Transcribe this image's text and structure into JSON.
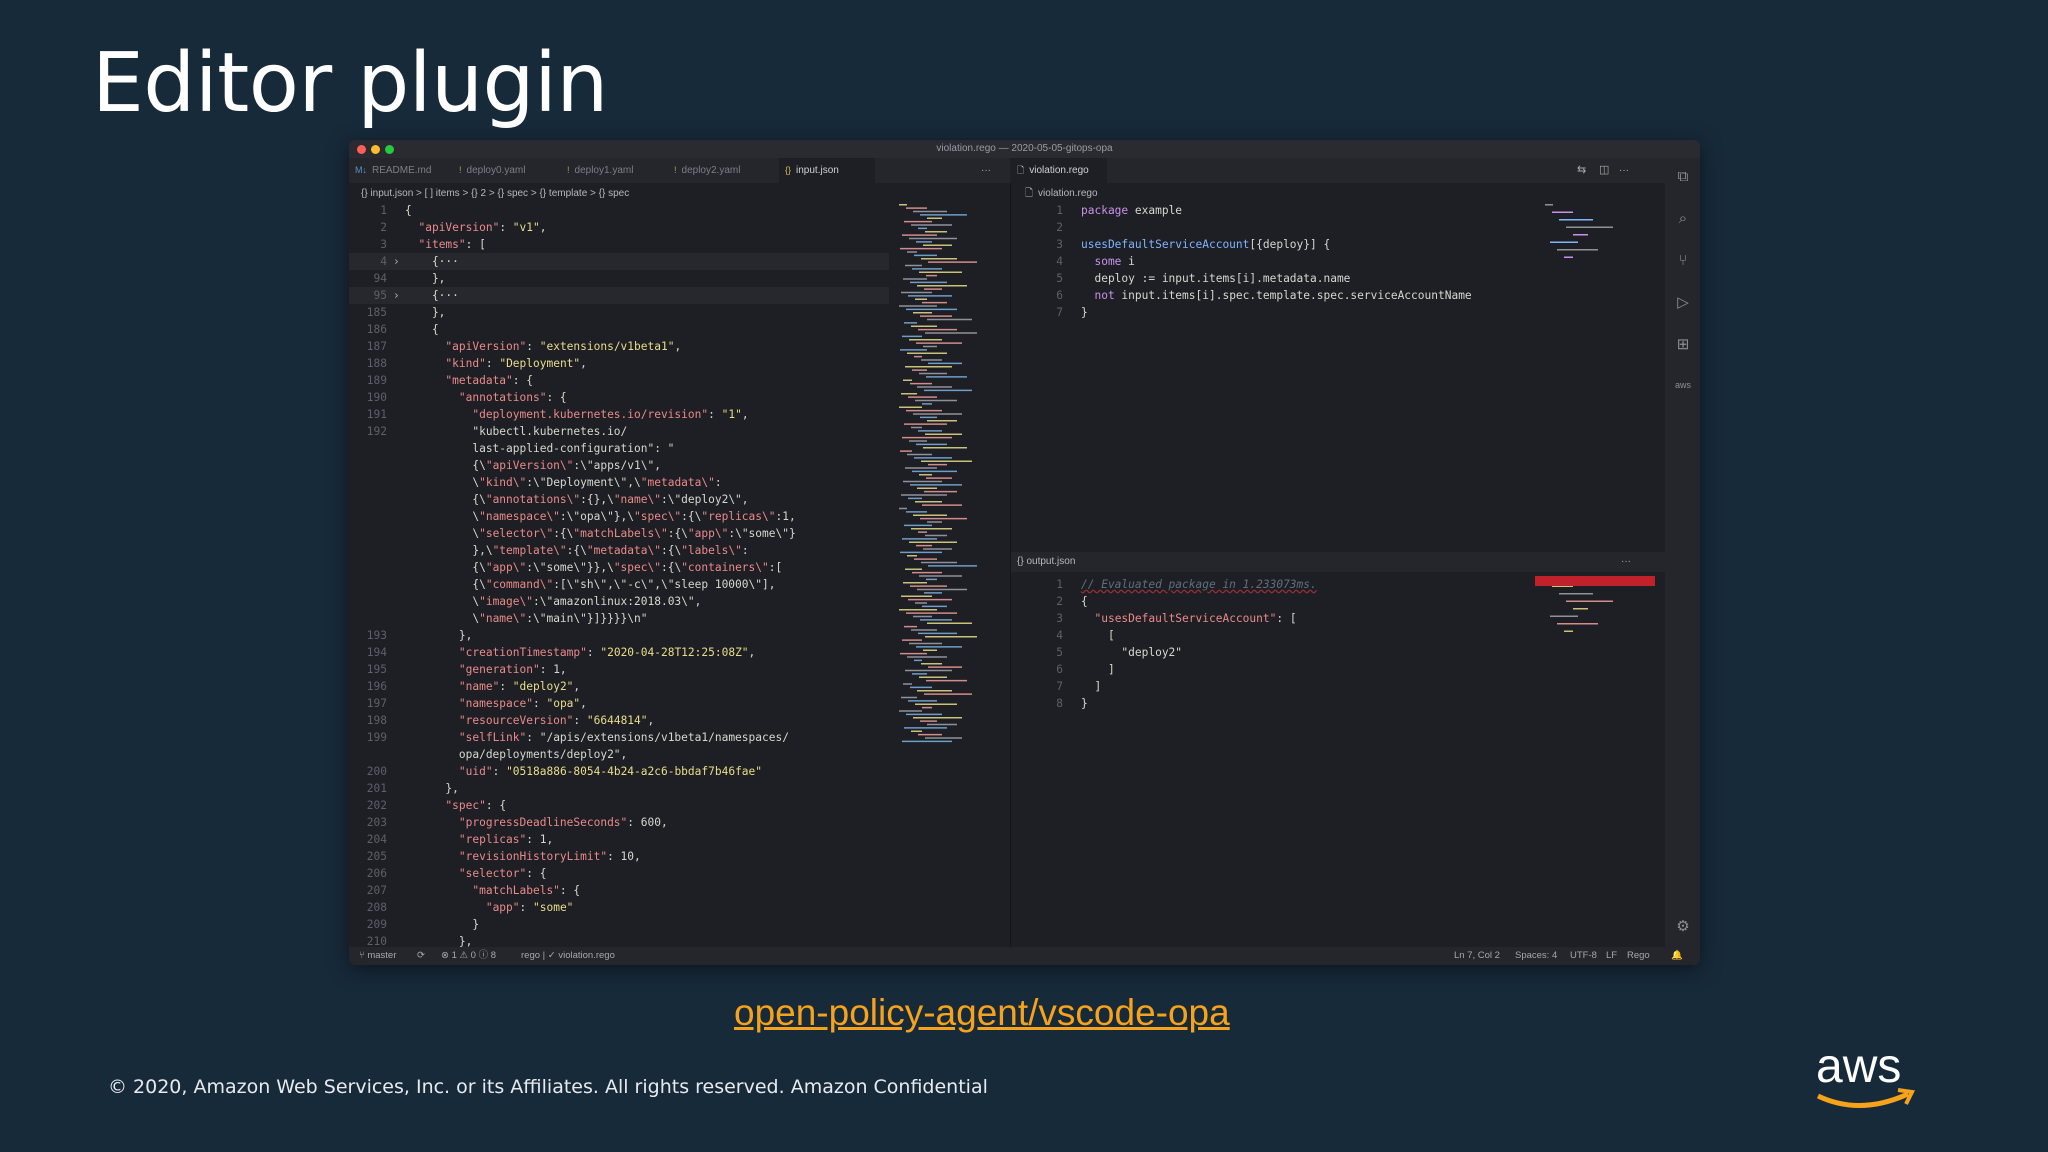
{
  "slide": {
    "title": "Editor plugin",
    "link": "open-policy-agent/vscode-opa",
    "copyright": "© 2020, Amazon Web Services, Inc. or its Affiliates. All rights reserved. Amazon Confidential",
    "logo_text": "aws"
  },
  "window": {
    "title": "violation.rego — 2020-05-05-gitops-opa",
    "traffic_colors": [
      "#ff5f57",
      "#febc2e",
      "#28c840"
    ]
  },
  "left_tabs": [
    {
      "label": "README.md",
      "icon": "markdown-icon"
    },
    {
      "label": "deploy0.yaml",
      "icon": "yaml-icon"
    },
    {
      "label": "deploy1.yaml",
      "icon": "yaml-icon"
    },
    {
      "label": "deploy2.yaml",
      "icon": "yaml-icon"
    },
    {
      "label": "input.json",
      "icon": "json-icon",
      "active": true
    }
  ],
  "right_tab": {
    "label": "violation.rego"
  },
  "left_breadcrumb": "{} input.json > [ ] items > {} 2 > {} spec > {} template > {} spec",
  "rego_breadcrumb": "violation.rego",
  "output_panel_title": "{} output.json",
  "rego_lines": [
    {
      "n": "1",
      "text": "package example"
    },
    {
      "n": "2",
      "text": ""
    },
    {
      "n": "3",
      "text": "usesDefaultServiceAccount[{deploy}] {"
    },
    {
      "n": "4",
      "text": "  some i"
    },
    {
      "n": "5",
      "text": "  deploy := input.items[i].metadata.name"
    },
    {
      "n": "6",
      "text": "  not input.items[i].spec.template.spec.serviceAccountName"
    },
    {
      "n": "7",
      "text": "}"
    }
  ],
  "output_lines": [
    {
      "n": "1",
      "text": "// Evaluated package in 1.233073ms."
    },
    {
      "n": "2",
      "text": "{"
    },
    {
      "n": "3",
      "text": "  \"usesDefaultServiceAccount\": ["
    },
    {
      "n": "4",
      "text": "    ["
    },
    {
      "n": "5",
      "text": "      \"deploy2\""
    },
    {
      "n": "6",
      "text": "    ]"
    },
    {
      "n": "7",
      "text": "  ]"
    },
    {
      "n": "8",
      "text": "}"
    }
  ],
  "json_lines": [
    {
      "n": "1",
      "text": "{"
    },
    {
      "n": "2",
      "text": "  \"apiVersion\": \"v1\","
    },
    {
      "n": "3",
      "text": "  \"items\": ["
    },
    {
      "n": "4",
      "text": "    {···",
      "fold": true
    },
    {
      "n": "94",
      "text": "    },"
    },
    {
      "n": "95",
      "text": "    {···",
      "fold": true
    },
    {
      "n": "185",
      "text": "    },"
    },
    {
      "n": "186",
      "text": "    {"
    },
    {
      "n": "187",
      "text": "      \"apiVersion\": \"extensions/v1beta1\","
    },
    {
      "n": "188",
      "text": "      \"kind\": \"Deployment\","
    },
    {
      "n": "189",
      "text": "      \"metadata\": {"
    },
    {
      "n": "190",
      "text": "        \"annotations\": {"
    },
    {
      "n": "191",
      "text": "          \"deployment.kubernetes.io/revision\": \"1\","
    },
    {
      "n": "192",
      "text": "          \"kubectl.kubernetes.io/"
    },
    {
      "n": "",
      "text": "          last-applied-configuration\": \""
    },
    {
      "n": "",
      "text": "          {\\\"apiVersion\\\":\\\"apps/v1\\\","
    },
    {
      "n": "",
      "text": "          \\\"kind\\\":\\\"Deployment\\\",\\\"metadata\\\":"
    },
    {
      "n": "",
      "text": "          {\\\"annotations\\\":{},\\\"name\\\":\\\"deploy2\\\","
    },
    {
      "n": "",
      "text": "          \\\"namespace\\\":\\\"opa\\\"},\\\"spec\\\":{\\\"replicas\\\":1,"
    },
    {
      "n": "",
      "text": "          \\\"selector\\\":{\\\"matchLabels\\\":{\\\"app\\\":\\\"some\\\"}"
    },
    {
      "n": "",
      "text": "          },\\\"template\\\":{\\\"metadata\\\":{\\\"labels\\\":"
    },
    {
      "n": "",
      "text": "          {\\\"app\\\":\\\"some\\\"}},\\\"spec\\\":{\\\"containers\\\":["
    },
    {
      "n": "",
      "text": "          {\\\"command\\\":[\\\"sh\\\",\\\"-c\\\",\\\"sleep 10000\\\"],"
    },
    {
      "n": "",
      "text": "          \\\"image\\\":\\\"amazonlinux:2018.03\\\","
    },
    {
      "n": "",
      "text": "          \\\"name\\\":\\\"main\\\"}]}}}}\\n\""
    },
    {
      "n": "193",
      "text": "        },"
    },
    {
      "n": "194",
      "text": "        \"creationTimestamp\": \"2020-04-28T12:25:08Z\","
    },
    {
      "n": "195",
      "text": "        \"generation\": 1,"
    },
    {
      "n": "196",
      "text": "        \"name\": \"deploy2\","
    },
    {
      "n": "197",
      "text": "        \"namespace\": \"opa\","
    },
    {
      "n": "198",
      "text": "        \"resourceVersion\": \"6644814\","
    },
    {
      "n": "199",
      "text": "        \"selfLink\": \"/apis/extensions/v1beta1/namespaces/"
    },
    {
      "n": "",
      "text": "        opa/deployments/deploy2\","
    },
    {
      "n": "200",
      "text": "        \"uid\": \"0518a886-8054-4b24-a2c6-bbdaf7b46fae\""
    },
    {
      "n": "201",
      "text": "      },"
    },
    {
      "n": "202",
      "text": "      \"spec\": {"
    },
    {
      "n": "203",
      "text": "        \"progressDeadlineSeconds\": 600,"
    },
    {
      "n": "204",
      "text": "        \"replicas\": 1,"
    },
    {
      "n": "205",
      "text": "        \"revisionHistoryLimit\": 10,"
    },
    {
      "n": "206",
      "text": "        \"selector\": {"
    },
    {
      "n": "207",
      "text": "          \"matchLabels\": {"
    },
    {
      "n": "208",
      "text": "            \"app\": \"some\""
    },
    {
      "n": "209",
      "text": "          }"
    },
    {
      "n": "210",
      "text": "        },"
    }
  ],
  "status": {
    "branch": "master",
    "problems": "⊗ 1 ⚠ 0 ⓘ 8",
    "rego": "rego | ✓ violation.rego",
    "position": "Ln 7, Col 2",
    "spaces": "Spaces: 4",
    "encoding": "UTF-8",
    "eol": "LF",
    "language": "Rego"
  },
  "activity_icons": [
    "files-icon",
    "search-icon",
    "source-control-icon",
    "run-debug-icon",
    "extensions-icon",
    "aws-icon",
    "settings-gear-icon"
  ]
}
